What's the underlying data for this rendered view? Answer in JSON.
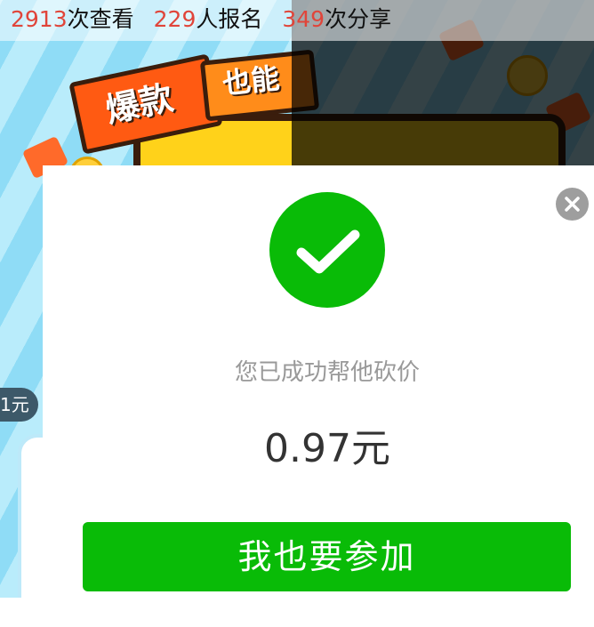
{
  "stats": {
    "views_count": "2913",
    "views_label": "次查看",
    "signups_count": "229",
    "signups_label": "人报名",
    "shares_count": "349",
    "shares_label": "次分享"
  },
  "poster": {
    "tag_1": "爆款",
    "tag_2": "也能",
    "price_chip": "1元"
  },
  "modal": {
    "message": "您已成功帮他砍价",
    "amount": "0.97元",
    "join_button": "我也要参加",
    "close_icon": "close-icon",
    "success_icon": "checkmark-icon"
  },
  "colors": {
    "accent_green": "#09bb07",
    "stat_number_red": "#e0453a"
  }
}
